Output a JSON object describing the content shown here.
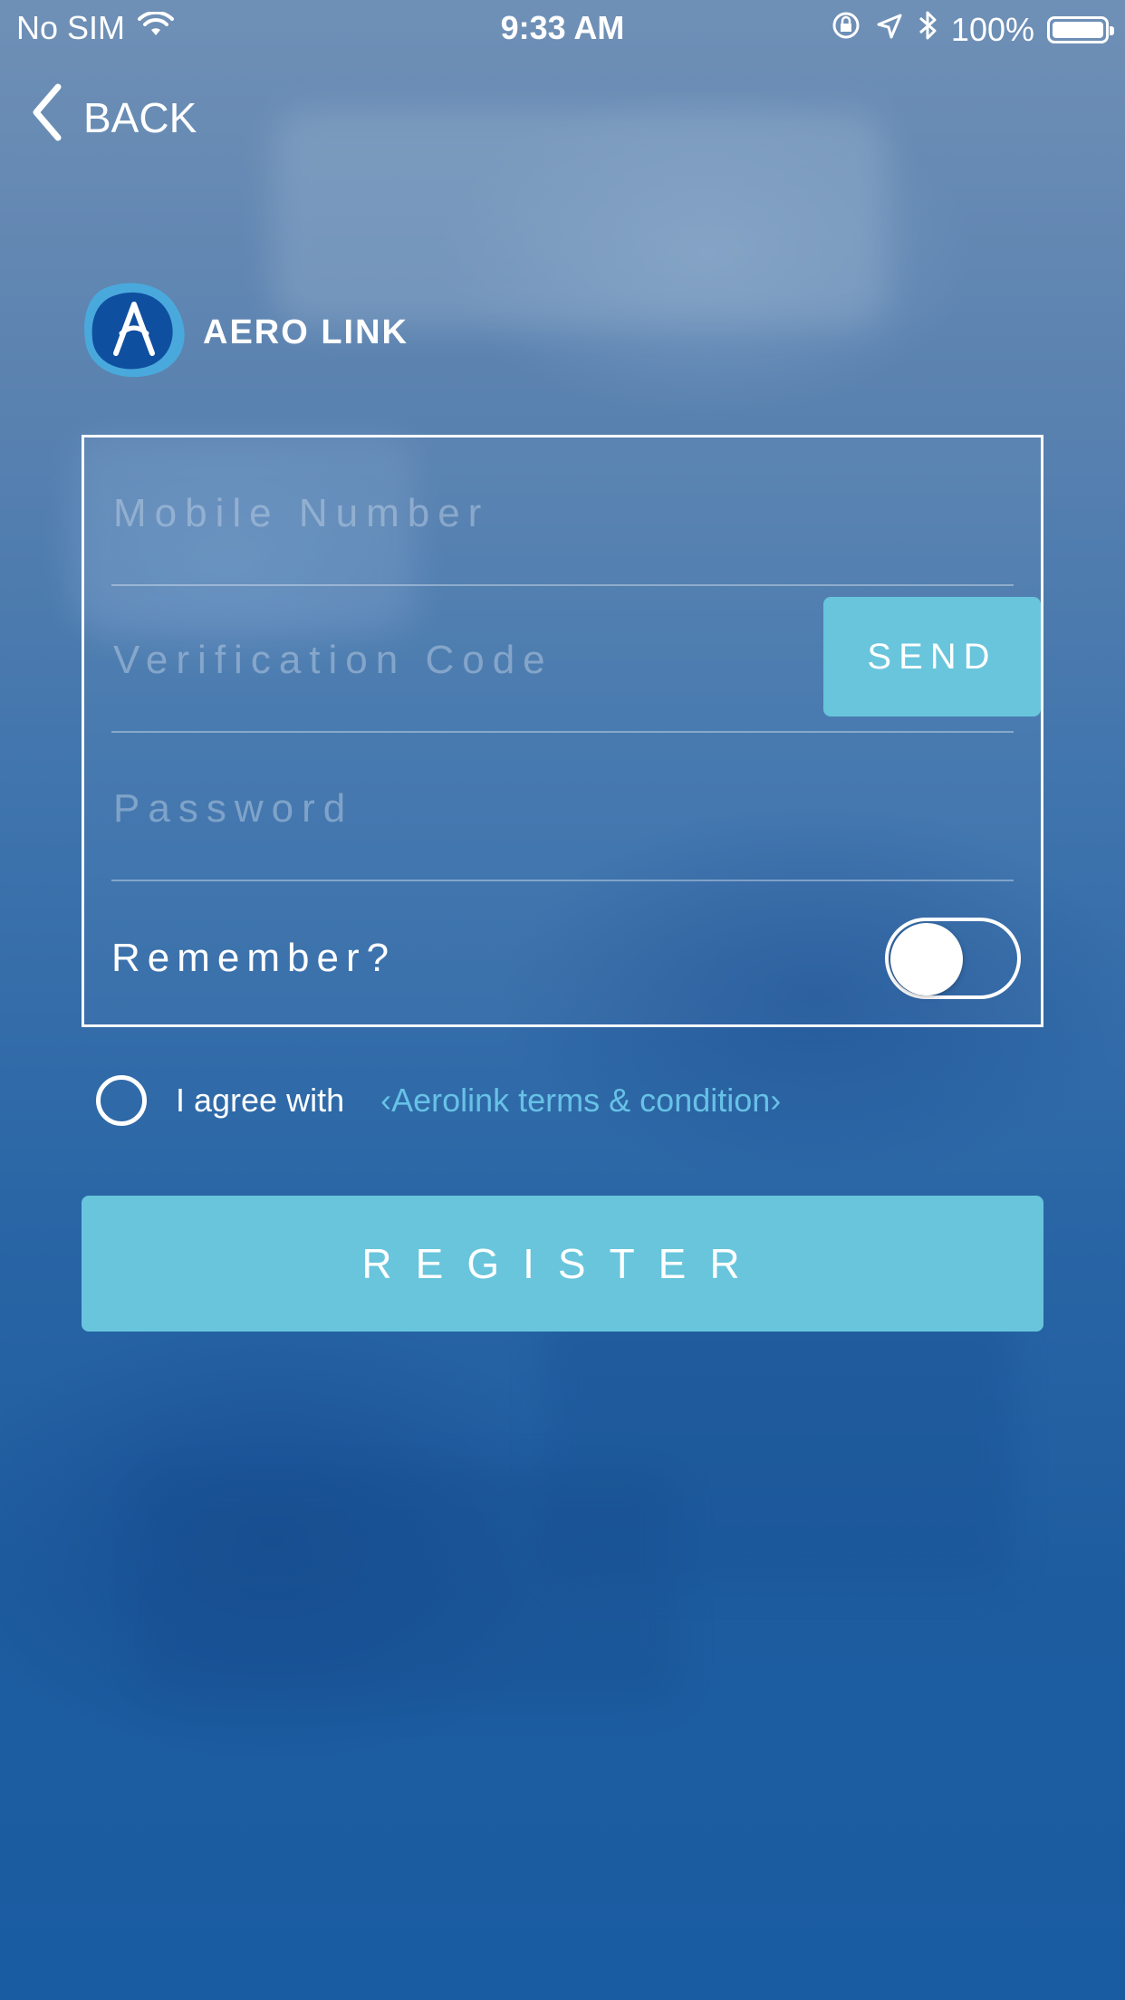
{
  "status_bar": {
    "carrier": "No SIM",
    "time": "9:33 AM",
    "battery": "100%"
  },
  "nav": {
    "back_label": "BACK"
  },
  "brand": {
    "name": "AERO LINK"
  },
  "form": {
    "mobile_placeholder": "Mobile Number",
    "code_placeholder": "Verification Code",
    "send_label": "SEND",
    "password_placeholder": "Password",
    "remember_label": "Remember?"
  },
  "agree": {
    "text": "I agree with",
    "link": "‹Aerolink terms & condition›"
  },
  "register_label": "REGISTER",
  "colors": {
    "accent": "#68c5dc",
    "link": "#67c2e6",
    "background_top": "#6f90b6",
    "background_bottom": "#1a5ca2"
  }
}
